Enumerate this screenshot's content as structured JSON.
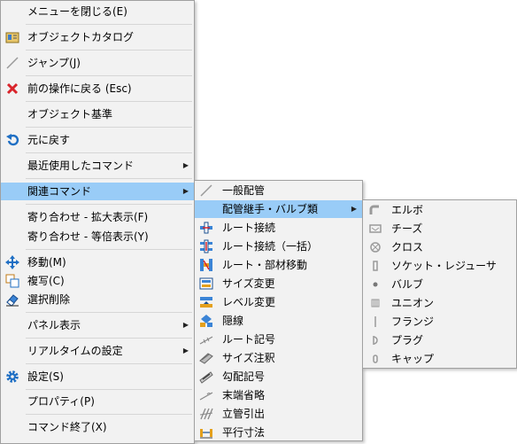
{
  "main_menu": {
    "items": [
      {
        "label": "メニューを閉じる(E)"
      },
      {
        "label": "オブジェクトカタログ",
        "icon": "catalog-icon"
      },
      {
        "label": "ジャンプ(J)",
        "icon": "jump-line-icon"
      },
      {
        "label": "前の操作に戻る (Esc)",
        "icon": "red-x-icon"
      },
      {
        "label": "オブジェクト基準"
      },
      {
        "label": "元に戻す",
        "icon": "undo-icon"
      },
      {
        "label": "最近使用したコマンド"
      },
      {
        "label": "関連コマンド"
      },
      {
        "label": "寄り合わせ - 拡大表示(F)"
      },
      {
        "label": "寄り合わせ - 等倍表示(Y)"
      },
      {
        "label": "移動(M)",
        "icon": "move-icon"
      },
      {
        "label": "複写(C)",
        "icon": "copy-icon"
      },
      {
        "label": "選択削除",
        "icon": "eraser-icon"
      },
      {
        "label": "パネル表示"
      },
      {
        "label": "リアルタイムの設定"
      },
      {
        "label": "設定(S)",
        "icon": "gear-icon"
      },
      {
        "label": "プロパティ(P)"
      },
      {
        "label": "コマンド終了(X)"
      }
    ]
  },
  "related_menu": {
    "items": [
      {
        "label": "一般配管",
        "icon": "general-pipe-icon"
      },
      {
        "label": "配管継手・バルブ類"
      },
      {
        "label": "ルート接続",
        "icon": "route-connect-icon"
      },
      {
        "label": "ルート接続（一括）",
        "icon": "route-connect-batch-icon"
      },
      {
        "label": "ルート・部材移動",
        "icon": "route-move-icon"
      },
      {
        "label": "サイズ変更",
        "icon": "size-change-icon"
      },
      {
        "label": "レベル変更",
        "icon": "level-change-icon"
      },
      {
        "label": "隠線",
        "icon": "hidden-line-icon"
      },
      {
        "label": "ルート記号",
        "icon": "route-symbol-icon"
      },
      {
        "label": "サイズ注釈",
        "icon": "size-annotation-icon"
      },
      {
        "label": "勾配記号",
        "icon": "slope-symbol-icon"
      },
      {
        "label": "末端省略",
        "icon": "end-omit-icon"
      },
      {
        "label": "立管引出",
        "icon": "riser-lead-icon"
      },
      {
        "label": "平行寸法",
        "icon": "parallel-dimension-icon"
      }
    ]
  },
  "fittings_menu": {
    "items": [
      {
        "label": "エルボ",
        "icon": "elbow-icon"
      },
      {
        "label": "チーズ",
        "icon": "tee-icon"
      },
      {
        "label": "クロス",
        "icon": "cross-icon"
      },
      {
        "label": "ソケット・レジューサ",
        "icon": "socket-icon"
      },
      {
        "label": "バルブ",
        "icon": "valve-icon"
      },
      {
        "label": "ユニオン",
        "icon": "union-icon"
      },
      {
        "label": "フランジ",
        "icon": "flange-icon"
      },
      {
        "label": "プラグ",
        "icon": "plug-icon"
      },
      {
        "label": "キャップ",
        "icon": "cap-icon"
      }
    ]
  },
  "submenu_arrow": "▶"
}
